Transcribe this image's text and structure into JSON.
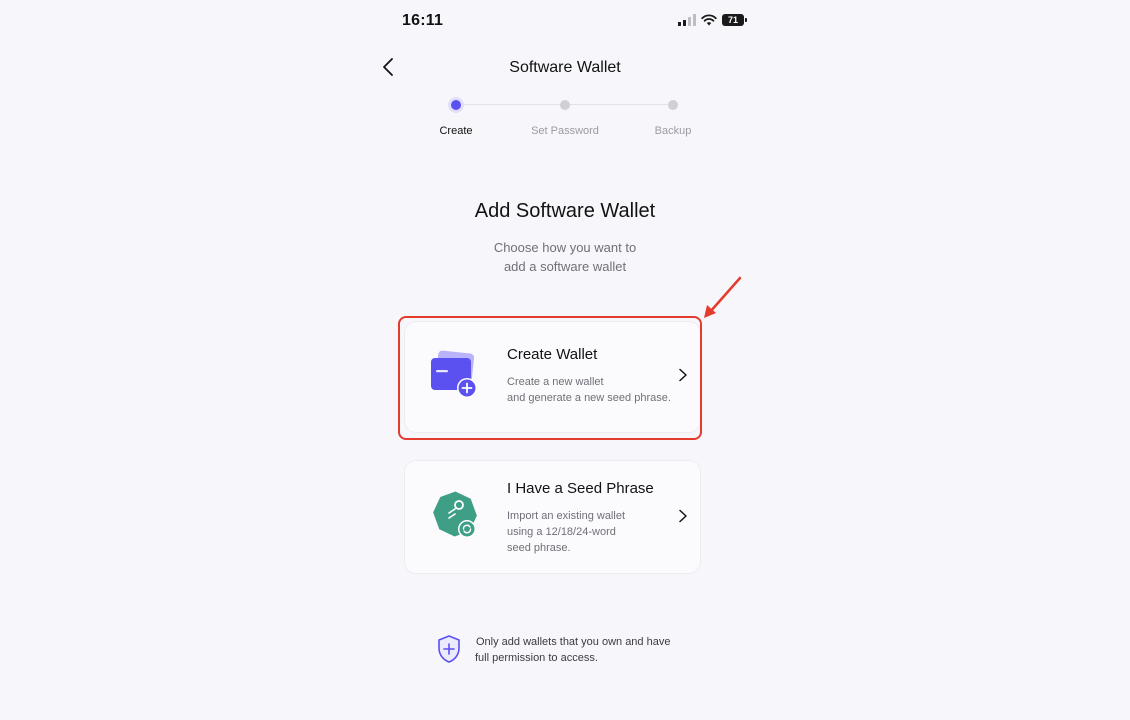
{
  "status_bar": {
    "time": "16:11",
    "battery": "71"
  },
  "header": {
    "title": "Software Wallet"
  },
  "stepper": {
    "steps": [
      {
        "label": "Create"
      },
      {
        "label": "Set Password"
      },
      {
        "label": "Backup"
      }
    ],
    "active_index": 0
  },
  "main": {
    "heading": "Add Software Wallet",
    "subheading_line1": "Choose how you want to",
    "subheading_line2": "add a software wallet"
  },
  "options": [
    {
      "title": "Create Wallet",
      "desc_line1": "Create a new wallet",
      "desc_line2": "and generate a new seed phrase."
    },
    {
      "title": "I Have a Seed Phrase",
      "desc_line1": "Import an existing wallet",
      "desc_line2": "using a 12/18/24-word",
      "desc_line3": "seed phrase."
    }
  ],
  "notice": {
    "line1": "Only add wallets that you own and have",
    "line2": "full permission to access."
  },
  "colors": {
    "accent": "#5b50f0",
    "highlight": "#e53a2e",
    "seed_icon": "#3f9f86"
  }
}
